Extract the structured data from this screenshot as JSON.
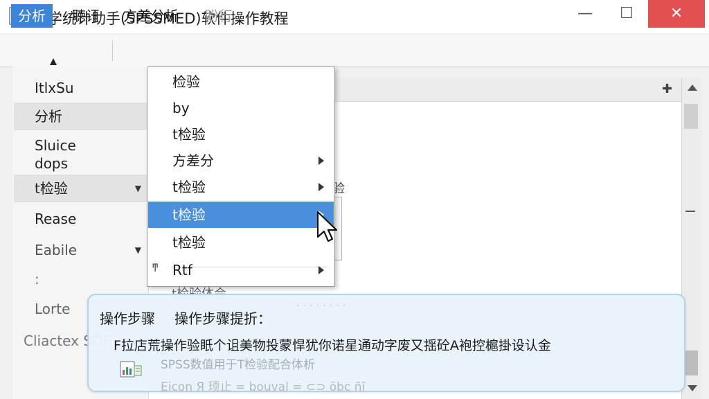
{
  "window": {
    "title": "医学统计助手(SPSSMED)软件操作教程",
    "minimize_glyph": "—",
    "maximize_glyph": "☐",
    "close_glyph": "✕",
    "icon": "app-chart-icon"
  },
  "menubar": {
    "items": [
      {
        "label": "分析",
        "state": "active"
      },
      {
        "label": "聴讦",
        "state": "normal"
      },
      {
        "label": "方差分析",
        "state": "normal"
      },
      {
        "label": "盼行",
        "state": "disabled"
      }
    ]
  },
  "sidebar": {
    "items": [
      {
        "label": "ItlxSu"
      },
      {
        "label": "分析"
      },
      {
        "label": "Sluice"
      },
      {
        "label": "dops"
      },
      {
        "label": "t检验"
      },
      {
        "label": "Rease"
      },
      {
        "label": "Eabile"
      },
      {
        "label": ":"
      },
      {
        "label": "Lorte"
      },
      {
        "label": "Cliactex SDF"
      }
    ]
  },
  "dropdown": {
    "items": [
      {
        "label": "检验",
        "submenu": false
      },
      {
        "label": "by",
        "submenu": false
      },
      {
        "label": "t检验",
        "submenu": false
      },
      {
        "label": "方差分",
        "submenu": true
      },
      {
        "label": "t检验",
        "submenu": true
      },
      {
        "label": "t检验",
        "submenu": true,
        "selected": true
      },
      {
        "label": "t检验",
        "submenu": false
      },
      {
        "label": "Rtf",
        "submenu": true
      }
    ],
    "separator_icon": "ͳ"
  },
  "background": {
    "fragment_1": "验",
    "fragment_2": "t检验体会"
  },
  "tip": {
    "title": "操作步骤",
    "subtitle": "操作步骤提折：",
    "body": "F拉店荒操作验眂个诅美物投蒙悍犹你诺星通动字废又揺砼A袍控槴掛设认金",
    "ghost_line_1": "SPSS数值用于T检验配合体析",
    "ghost_line_2": "Eicon    Я 顼止    = bouval = ⊂⊃ ōbc  ñī  ",
    "icon": "chart-document-icon"
  },
  "colors": {
    "accent": "#3d85d8",
    "selected": "#4a8fdc",
    "close": "#e25050",
    "tip_bg": "#e8f2fa"
  }
}
